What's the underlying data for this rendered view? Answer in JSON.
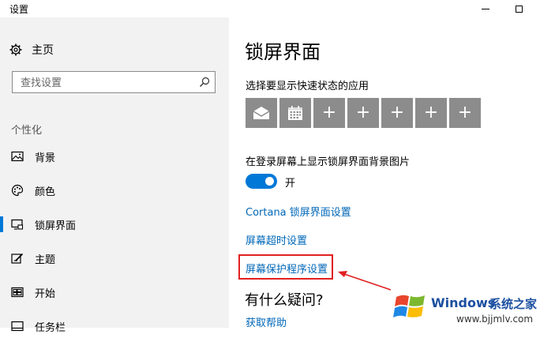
{
  "window": {
    "title": "设置"
  },
  "sidebar": {
    "home_label": "主页",
    "search_placeholder": "查找设置",
    "section_label": "个性化",
    "items": [
      {
        "label": "背景",
        "icon": "picture-icon"
      },
      {
        "label": "颜色",
        "icon": "palette-icon"
      },
      {
        "label": "锁屏界面",
        "icon": "lockscreen-icon",
        "active": true
      },
      {
        "label": "主题",
        "icon": "theme-icon"
      },
      {
        "label": "开始",
        "icon": "start-icon"
      },
      {
        "label": "任务栏",
        "icon": "taskbar-icon"
      }
    ]
  },
  "main": {
    "page_title": "锁屏界面",
    "quick_status_label": "选择要显示快速状态的应用",
    "quick_tiles": [
      "mail-icon",
      "calendar-icon",
      "plus",
      "plus",
      "plus",
      "plus",
      "plus"
    ],
    "bg_on_signin_label": "在登录屏幕上显示锁屏界面背景图片",
    "toggle_state_label": "开",
    "links": {
      "cortana": "Cortana 锁屏界面设置",
      "screen_timeout": "屏幕超时设置",
      "screensaver": "屏幕保护程序设置"
    },
    "help_title": "有什么疑问?",
    "help_link": "获取帮助"
  },
  "watermark": {
    "brand": "Windows",
    "cn_text": "系统之家",
    "url": "www.bjjmlv.com"
  },
  "colors": {
    "accent": "#0078d7",
    "link": "#0067b8",
    "highlight": "#e02020",
    "tile": "#8c8c8c",
    "sidebar_bg": "#f2f2f2"
  }
}
